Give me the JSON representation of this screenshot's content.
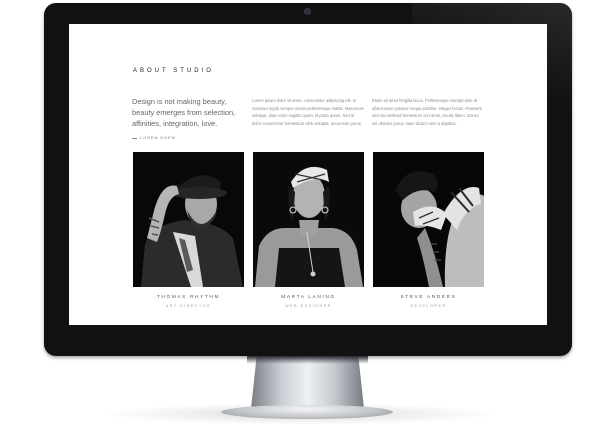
{
  "about": {
    "title": "ABOUT STUDIO",
    "lead": "Design is not making beauty, beauty emerges from selection, affinities, integration, love.",
    "learn_more": "LOREM KNEW",
    "column_2": "Lorem ipsum dolor sit amet, consectetur adipiscing elit. In maximus ligula semper metus pellentesque mattis. Maecenas volutpat, diam enim sagittis quam, id porta quam. Sed id dolor consectetur fermentum nibh volutpat, accumsan purus.",
    "column_3": "Etiam sit amet fringilla lacus. Pellentesque suscipit ante at ullamcorper pulvinar neque porttitor. Integer lectus. Praesent sed nisi eleifend fermentum orci amet, iaculis libero. Donec vel ultricies purus. Nam dictum sem a dapibus."
  },
  "team": [
    {
      "name": "THOMAS RHYTHM",
      "role": "ART DIRECTOR"
    },
    {
      "name": "MARTA LANING",
      "role": "WEB DESIGNER"
    },
    {
      "name": "STEVE ANDERS",
      "role": "DEVELOPER"
    }
  ]
}
